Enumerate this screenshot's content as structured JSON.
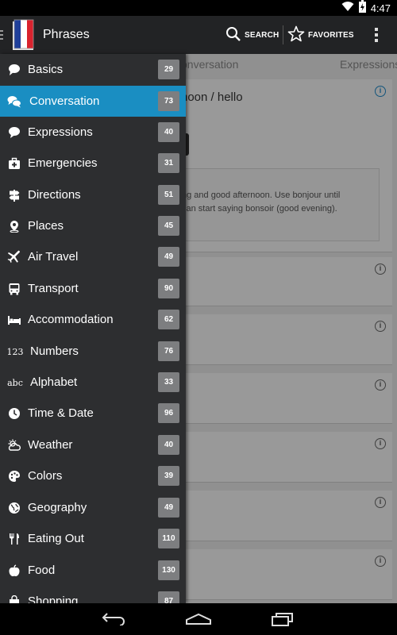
{
  "status_bar": {
    "time": "4:47",
    "icons": [
      "wifi-icon",
      "battery-charging-icon"
    ]
  },
  "action_bar": {
    "title": "Phrases",
    "app_icon": "french-flag-phrasebook-icon",
    "search_label": "SEARCH",
    "favorites_label": "FAVORITES",
    "overflow_icon": "overflow-menu-icon"
  },
  "content": {
    "tabs": [
      "onversation",
      "Expressions"
    ],
    "first_card_title": "noon / hello",
    "note_line_1": "ng and good afternoon. Use bonjour until",
    "note_line_2": "can start saying bonsoir (good evening)."
  },
  "drawer": {
    "selected_index": 1,
    "selected_color": "#1a8ec2",
    "items": [
      {
        "label": "Basics",
        "count": "29",
        "icon": "chat-bubble-icon"
      },
      {
        "label": "Conversation",
        "count": "73",
        "icon": "chat-bubbles-icon"
      },
      {
        "label": "Expressions",
        "count": "40",
        "icon": "speech-bubble-icon"
      },
      {
        "label": "Emergencies",
        "count": "31",
        "icon": "first-aid-kit-icon"
      },
      {
        "label": "Directions",
        "count": "51",
        "icon": "signpost-icon"
      },
      {
        "label": "Places",
        "count": "45",
        "icon": "map-pin-icon"
      },
      {
        "label": "Air Travel",
        "count": "49",
        "icon": "airplane-icon"
      },
      {
        "label": "Transport",
        "count": "90",
        "icon": "bus-icon"
      },
      {
        "label": "Accommodation",
        "count": "62",
        "icon": "bed-icon"
      },
      {
        "label": "Numbers",
        "count": "76",
        "icon": "numbers-icon",
        "icon_text": "123"
      },
      {
        "label": "Alphabet",
        "count": "33",
        "icon": "alphabet-icon",
        "icon_text": "abc"
      },
      {
        "label": "Time & Date",
        "count": "96",
        "icon": "clock-icon"
      },
      {
        "label": "Weather",
        "count": "40",
        "icon": "weather-icon"
      },
      {
        "label": "Colors",
        "count": "39",
        "icon": "palette-icon"
      },
      {
        "label": "Geography",
        "count": "49",
        "icon": "globe-icon"
      },
      {
        "label": "Eating Out",
        "count": "110",
        "icon": "fork-knife-icon"
      },
      {
        "label": "Food",
        "count": "130",
        "icon": "apple-icon"
      },
      {
        "label": "Shopping",
        "count": "87",
        "icon": "shopping-bag-icon"
      }
    ]
  },
  "nav_bar": {
    "back_icon": "back-icon",
    "home_icon": "home-icon",
    "recents_icon": "recent-apps-icon"
  }
}
